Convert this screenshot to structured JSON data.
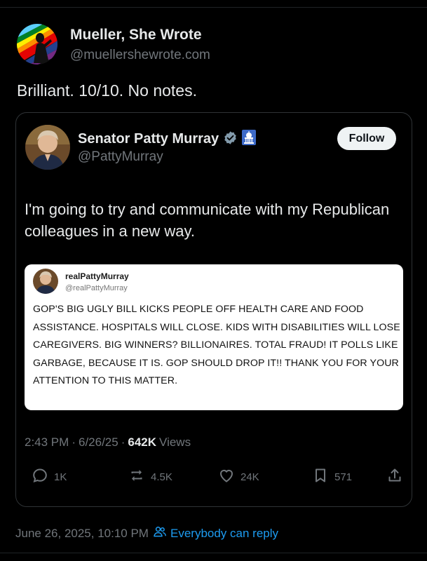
{
  "post": {
    "author_name": "Mueller, She Wrote",
    "author_handle": "@muellershewrote.com",
    "text": "Brilliant. 10/10. No notes.",
    "date_time": "June 26, 2025, 10:10 PM",
    "separator": "·",
    "reply_setting": "Everybody can reply"
  },
  "quote": {
    "author_name": "Senator Patty Murray",
    "author_handle": "@PattyMurray",
    "follow_label": "Follow",
    "text": "I'm going to try and communicate with my Republican colleagues in a new way.",
    "embed": {
      "name": "realPattyMurray",
      "handle": "@realPattyMurray",
      "text": "GOP'S BIG UGLY BILL KICKS PEOPLE OFF HEALTH CARE AND FOOD ASSISTANCE. HOSPITALS WILL CLOSE. KIDS WITH DISABILITIES WILL LOSE CAREGIVERS. BIG WINNERS? BILLIONAIRES. TOTAL FRAUD! IT POLLS LIKE GARBAGE, BECAUSE IT IS. GOP SHOULD DROP IT!! THANK YOU FOR YOUR ATTENTION TO THIS MATTER."
    },
    "time": "2:43 PM",
    "date": "6/26/25",
    "dot": "·",
    "views_count": "642K",
    "views_label": "Views",
    "replies": "1K",
    "reposts": "4.5K",
    "likes": "24K",
    "bookmarks": "571"
  },
  "colors": {
    "background": "#000000",
    "text_primary": "#e7e9ea",
    "text_secondary": "#71767b",
    "accent_blue": "#1d9bf0",
    "verified_gray": "#829aab"
  },
  "icons": [
    "reply-icon",
    "repost-icon",
    "like-icon",
    "bookmark-icon",
    "share-icon",
    "verified-badge-icon",
    "capitol-badge-icon",
    "people-icon"
  ]
}
